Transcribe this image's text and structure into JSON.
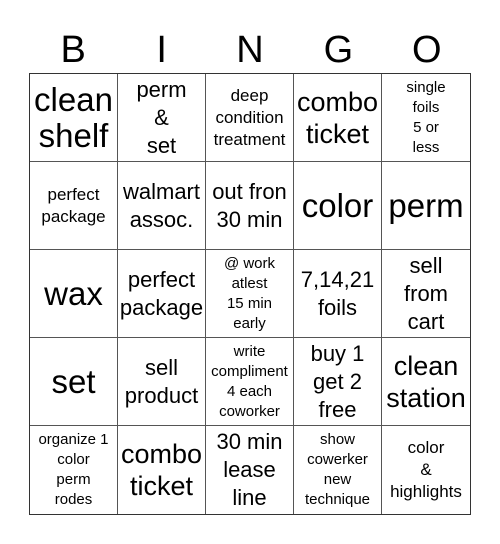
{
  "header": [
    "B",
    "I",
    "N",
    "G",
    "O"
  ],
  "cells": [
    {
      "text": "clean\nshelf",
      "size": "xl"
    },
    {
      "text": "perm\n&\nset",
      "size": "m"
    },
    {
      "text": "deep\ncondition\ntreatment",
      "size": "s"
    },
    {
      "text": "combo\nticket",
      "size": "l"
    },
    {
      "text": "single\nfoils\n5 or\nless",
      "size": "xs"
    },
    {
      "text": "perfect\npackage",
      "size": "s"
    },
    {
      "text": "walmart\nassoc.",
      "size": "m"
    },
    {
      "text": "out fron\n30 min",
      "size": "m"
    },
    {
      "text": "color",
      "size": "xl"
    },
    {
      "text": "perm",
      "size": "xl"
    },
    {
      "text": "wax",
      "size": "xl"
    },
    {
      "text": "perfect\npackage",
      "size": "m"
    },
    {
      "text": "@ work\natlest\n15 min\nearly",
      "size": "xs"
    },
    {
      "text": "7,14,21\nfoils",
      "size": "m"
    },
    {
      "text": "sell\nfrom\ncart",
      "size": "m"
    },
    {
      "text": "set",
      "size": "xl"
    },
    {
      "text": "sell\nproduct",
      "size": "m"
    },
    {
      "text": "write\ncompliment\n4 each\ncoworker",
      "size": "xs"
    },
    {
      "text": "buy 1\nget 2\nfree",
      "size": "m"
    },
    {
      "text": "clean\nstation",
      "size": "l"
    },
    {
      "text": "organize 1\ncolor\nperm\nrodes",
      "size": "xs"
    },
    {
      "text": "combo\nticket",
      "size": "l"
    },
    {
      "text": "30 min\nlease\nline",
      "size": "m"
    },
    {
      "text": "show\ncowerker\nnew\ntechnique",
      "size": "xs"
    },
    {
      "text": "color\n&\nhighlights",
      "size": "s"
    }
  ]
}
